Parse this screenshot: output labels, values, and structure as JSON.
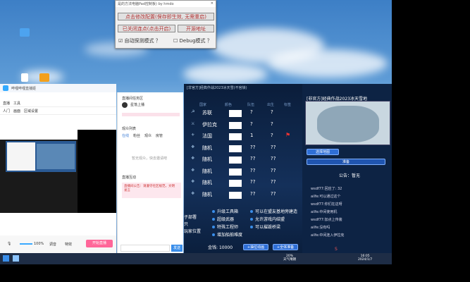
{
  "tool": {
    "title": "是的方法电脑Pad控制板) by hmdo",
    "btn_config": "点击修改配置(保存即生效, 无需重启)",
    "btn_close": "已关闭连点(点击开启)",
    "btn_open": "开源地址",
    "chk_auto": "自动探测模式 ？",
    "chk_debug": "Debug模式 ？"
  },
  "obs": {
    "title": "哔哩哔哩直播姬",
    "tab_live": "直播",
    "tab_tools": "工具",
    "tab_a": "人门",
    "tab_b": "画面",
    "tab_c": "区域设置",
    "volume": "100%",
    "mic": "调音",
    "effect": "特效",
    "start_live": "开始直播"
  },
  "chat": {
    "header": "直播间任务区",
    "room": "星落上播",
    "tab_a": "在线",
    "tab_b": "粉丝",
    "tab_c": "观众",
    "tab_d": "房管",
    "section": "观众列表",
    "empty": "暂无观众，快去邀请吧",
    "danmu_title": "直播互动",
    "notice": "直播间公告：请遵守社区规范，文明发言",
    "send": "发送"
  },
  "game": {
    "title": "[非官方]经典作战2023冰天雪(不官锁)",
    "h_faction": "国家",
    "h_color": "颜色",
    "h_team": "队伍",
    "h_start": "出生",
    "h_tag": "标签",
    "rows": [
      {
        "faction": "苏联",
        "team": "?",
        "start": "?"
      },
      {
        "faction": "伊拉克",
        "team": "?",
        "start": "?"
      },
      {
        "faction": "法国",
        "team": "1",
        "start": "?"
      },
      {
        "faction": "随机",
        "team": "??",
        "start": "??"
      },
      {
        "faction": "随机",
        "team": "??",
        "start": "??"
      },
      {
        "faction": "随机",
        "team": "??",
        "start": "??"
      },
      {
        "faction": "随机",
        "team": "??",
        "start": "??"
      },
      {
        "faction": "随机",
        "team": "??",
        "start": "??"
      }
    ],
    "opts": [
      "升级工具箱",
      "超级武器",
      "特殊工程师",
      "增加船舶难度",
      "可以在盟友基地旁建造",
      "允许游戏内结盟",
      "可以摧毁桥梁"
    ],
    "left_opts": [
      "子部署",
      "只",
      "玩家位置"
    ],
    "money_label": "金钱:",
    "money": "10000",
    "btn_pos": "+抽位动画",
    "btn_all": "+全体准备"
  },
  "rightp": {
    "title": "[非官方]经典作战2023冰天雪地",
    "map_btn": "选择地图",
    "ready_btn": "准备",
    "notice": "公告：暂无",
    "chat": [
      "wsdf77:回应了: 32",
      "ailfe:可以通过这个",
      "wsdf77:你们在这呀",
      "ailfe:中间使用机",
      "wsdf77:加点上传装",
      "ailfe:没有吗",
      "ailfe:中间连入伊拉克"
    ]
  },
  "taskbar": {
    "temp": "20%",
    "weather": "天气晴朗",
    "time": "16:05",
    "date": "2024/1/7"
  }
}
